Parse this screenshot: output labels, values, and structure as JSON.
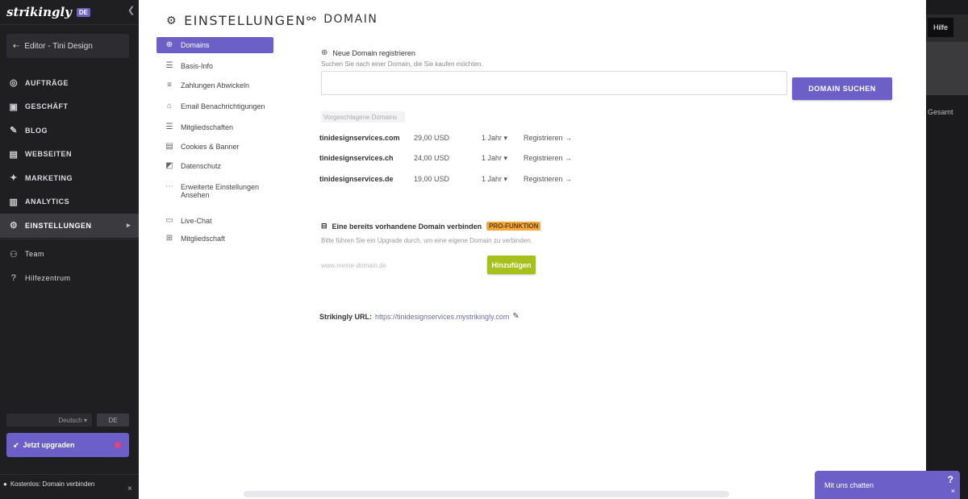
{
  "sidebar": {
    "logo": "strikingly",
    "logo_badge": "DE",
    "editor_button": "Editor - Tini Design",
    "nav": [
      {
        "label": "AUFTRÄGE",
        "icon": "orders-icon",
        "glyph": "◎"
      },
      {
        "label": "GESCHÄFT",
        "icon": "store-icon",
        "glyph": "▣"
      },
      {
        "label": "BLOG",
        "icon": "blog-icon",
        "glyph": "✎"
      },
      {
        "label": "WEBSEITEN",
        "icon": "pages-icon",
        "glyph": "▤"
      },
      {
        "label": "MARKETING",
        "icon": "marketing-icon",
        "glyph": "✦"
      },
      {
        "label": "ANALYTICS",
        "icon": "analytics-icon",
        "glyph": "▥"
      },
      {
        "label": "EINSTELLUNGEN",
        "icon": "settings-icon",
        "glyph": "⚙",
        "active": true
      }
    ],
    "lower": [
      {
        "label": "Team",
        "icon": "team-icon",
        "glyph": "⚇"
      },
      {
        "label": "Hilfezentrum",
        "icon": "help-icon",
        "glyph": "?"
      }
    ],
    "language_select": "Deutsch",
    "language_button": "DE",
    "upgrade_button": "Jetzt upgraden",
    "footer_message": "Kostenlos: Domain verbinden",
    "footer_close": "×"
  },
  "settings": {
    "title": "EINSTELLUNGEN",
    "subnav": [
      {
        "label": "Domains",
        "icon": "globe-icon",
        "glyph": "⊕",
        "active": true
      },
      {
        "label": "Basis-Info",
        "icon": "info-icon",
        "glyph": "☰"
      },
      {
        "label": "Zahlungen Abwickeln",
        "icon": "payments-icon",
        "glyph": "≡"
      },
      {
        "label": "Email Benachrichtigungen",
        "icon": "bell-icon",
        "glyph": "⌂"
      },
      {
        "label": "Mitgliedschaften",
        "icon": "members-icon",
        "glyph": "☰"
      },
      {
        "label": "Cookies & Banner",
        "icon": "cookies-icon",
        "glyph": "▤"
      },
      {
        "label": "Datenschutz",
        "icon": "privacy-icon",
        "glyph": "◩"
      },
      {
        "label": "Erweiterte Einstellungen Ansehen",
        "icon": "advanced-icon",
        "glyph": "⋯"
      },
      {
        "label": "Live-Chat",
        "icon": "chat-icon",
        "glyph": "▭"
      },
      {
        "label": "Mitgliedschaft",
        "icon": "membership-icon",
        "glyph": "⊞"
      }
    ]
  },
  "domain": {
    "title": "DOMAIN",
    "register_heading": "Neue Domain registrieren",
    "register_desc": "Suchen Sie nach einer Domain, die Sie kaufen möchten.",
    "search_placeholder": "",
    "search_button": "DOMAIN SUCHEN",
    "suggestions_label": "Vorgeschlagene Domains",
    "suggestions": [
      {
        "domain": "tinidesignservices.com",
        "price": "29,00 USD",
        "years": "1 Jahr",
        "action": "Registrieren"
      },
      {
        "domain": "tinidesignservices.ch",
        "price": "24,00 USD",
        "years": "1 Jahr",
        "action": "Registrieren"
      },
      {
        "domain": "tinidesignservices.de",
        "price": "19,00 USD",
        "years": "1 Jahr",
        "action": "Registrieren"
      }
    ],
    "connect_heading": "Eine bereits vorhandene Domain verbinden",
    "pro_badge": "PRO-FUNKTION",
    "connect_desc": "Bitte führen Sie ein Upgrade durch, um eine eigene Domain zu verbinden.",
    "connect_placeholder": "www.meine-domain.de",
    "connect_button": "Hinzufügen",
    "url_label": "Strikingly URL:",
    "url_value": "https://tinidesignservices.mystrikingly.com",
    "url_edit_icon": "✎"
  },
  "right": {
    "top_button": "Hilfe",
    "side_text": "Gesamt"
  },
  "chat": {
    "label": "Mit uns chatten",
    "help": "?",
    "close": "×"
  },
  "colors": {
    "accent": "#6c5fc7",
    "sidebar": "#1f1f22",
    "pro": "#f2a93b",
    "connect": "#a6c21a"
  }
}
